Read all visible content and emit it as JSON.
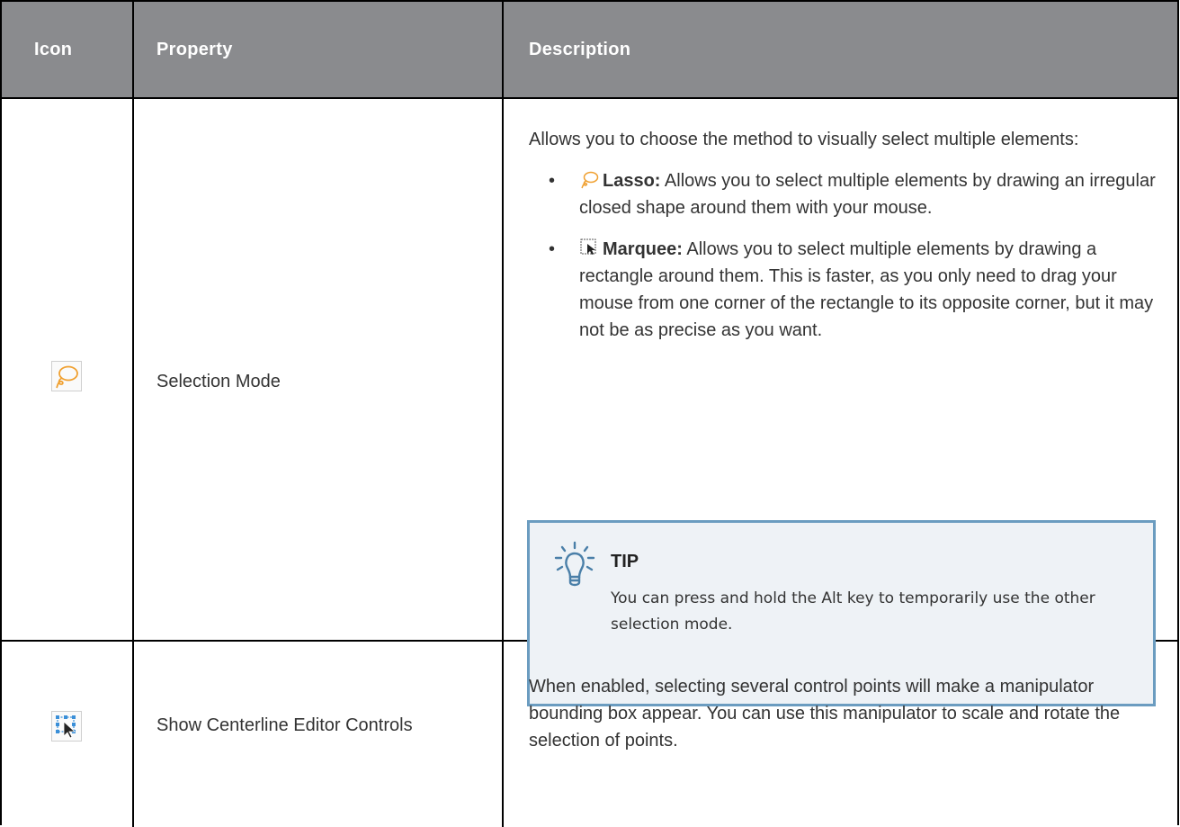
{
  "headers": {
    "icon": "Icon",
    "property": "Property",
    "description": "Description"
  },
  "rows": [
    {
      "icon": "lasso-icon",
      "property": "Selection Mode",
      "description": "Allows you to choose the method to visually select multiple elements:",
      "options": [
        {
          "icon": "lasso-icon",
          "name": "Lasso:",
          "text": "Allows you to select multiple elements by drawing an irregular closed shape around them with your mouse."
        },
        {
          "icon": "marquee-icon",
          "name": "Marquee:",
          "text": "Allows you to select multiple elements by drawing a rectangle around them. This is faster, as you only need to drag your mouse from one corner of the rectangle to its opposite corner, but it may not be as precise as you want."
        }
      ],
      "tip": {
        "icon": "lightbulb-icon",
        "title": "TIP",
        "text": "You can press and hold the Alt key to temporarily use the other selection mode."
      }
    },
    {
      "icon": "centerline-editor-icon",
      "property": "Show Centerline Editor Controls",
      "description": "When enabled, selecting several control points will make a manipulator bounding box appear. You can use this manipulator to scale and rotate the selection of points."
    }
  ],
  "colors": {
    "header_bg": "#8a8b8e",
    "tip_border": "#6b9cc0",
    "tip_bg": "#eef2f6",
    "lasso_orange": "#f0a030",
    "selection_blue": "#3a8fd8"
  }
}
